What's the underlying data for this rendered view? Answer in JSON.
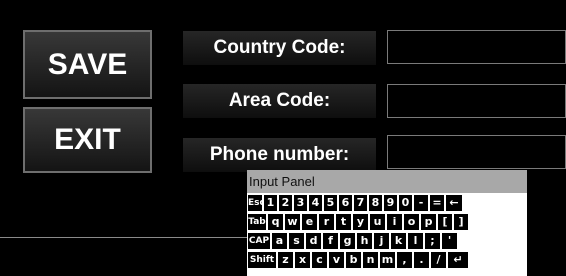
{
  "buttons": {
    "save": "SAVE",
    "exit": "EXIT"
  },
  "form": {
    "country_code": {
      "label": "Country Code:",
      "value": ""
    },
    "area_code": {
      "label": "Area Code:",
      "value": ""
    },
    "phone_number": {
      "label": "Phone number:",
      "value": ""
    }
  },
  "input_panel": {
    "title": "Input Panel",
    "rows": [
      [
        "Esc",
        "1",
        "2",
        "3",
        "4",
        "5",
        "6",
        "7",
        "8",
        "9",
        "0",
        "-",
        "=",
        "←"
      ],
      [
        "Tab",
        "q",
        "w",
        "e",
        "r",
        "t",
        "y",
        "u",
        "i",
        "o",
        "p",
        "[",
        "]"
      ],
      [
        "CAP",
        "a",
        "s",
        "d",
        "f",
        "g",
        "h",
        "j",
        "k",
        "l",
        ";",
        "'"
      ],
      [
        "Shift",
        "z",
        "x",
        "c",
        "v",
        "b",
        "n",
        "m",
        ",",
        ".",
        "/",
        "↵"
      ]
    ]
  }
}
